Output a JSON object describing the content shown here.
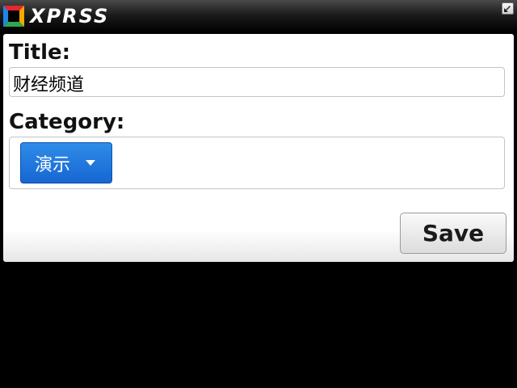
{
  "app": {
    "name": "XPRSS"
  },
  "titlebar": {
    "resize_icon": "resize-arrow-icon"
  },
  "form": {
    "title_label": "Title:",
    "title_value": "财经频道",
    "category_label": "Category:",
    "category_selected": "演示",
    "save_label": "Save"
  },
  "colors": {
    "dropdown_blue": "#1f75dd",
    "titlebar_dark": "#000000",
    "panel_bg": "#ffffff"
  }
}
